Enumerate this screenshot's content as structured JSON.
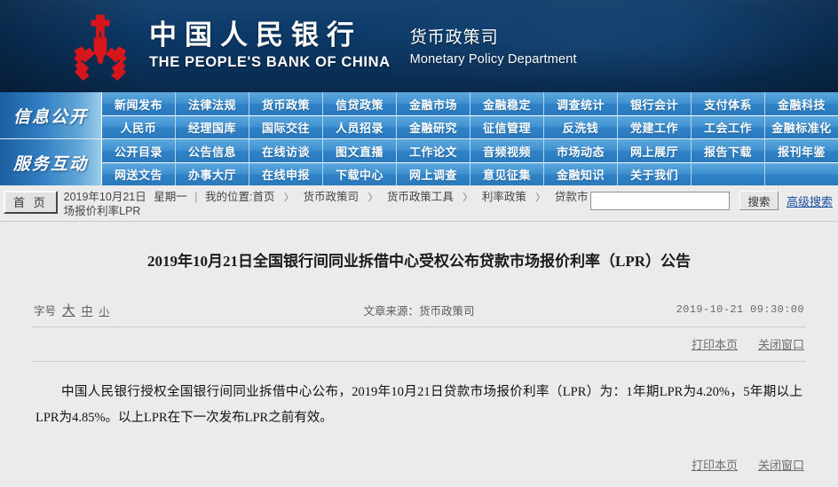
{
  "header": {
    "bank_name_cn": "中国人民银行",
    "bank_name_en": "THE PEOPLE'S BANK OF CHINA",
    "department_cn": "货币政策司",
    "department_en": "Monetary Policy Department",
    "logo_color": "#d7161b",
    "background_color": "#0c3a69"
  },
  "nav": {
    "groups": [
      {
        "side_label": "信息公开",
        "rows": [
          [
            "新闻发布",
            "法律法规",
            "货币政策",
            "信贷政策",
            "金融市场",
            "金融稳定",
            "调查统计",
            "银行会计",
            "支付体系",
            "金融科技"
          ],
          [
            "人民币",
            "经理国库",
            "国际交往",
            "人员招录",
            "金融研究",
            "征信管理",
            "反洗钱",
            "党建工作",
            "工会工作",
            "金融标准化"
          ]
        ]
      },
      {
        "side_label": "服务互动",
        "rows": [
          [
            "公开目录",
            "公告信息",
            "在线访谈",
            "图文直播",
            "工作论文",
            "音频视频",
            "市场动态",
            "网上展厅",
            "报告下载",
            "报刊年鉴"
          ],
          [
            "网送文告",
            "办事大厅",
            "在线申报",
            "下载中心",
            "网上调查",
            "意见征集",
            "金融知识",
            "关于我们",
            "",
            ""
          ]
        ]
      }
    ]
  },
  "breadcrumb": {
    "home_button": "首 页",
    "date": "2019年10月21日",
    "weekday": "星期一",
    "location_label": "我的位置:",
    "items": [
      "首页",
      "货币政策司",
      "货币政策工具",
      "利率政策",
      "贷款市场报价利率LPR"
    ],
    "separator": "〉"
  },
  "search": {
    "value": "",
    "placeholder": "",
    "button_label": "搜索",
    "advanced_label": "高级搜索",
    "link_color": "#1d4fa0"
  },
  "article": {
    "title": "2019年10月21日全国银行间同业拆借中心受权公布贷款市场报价利率（LPR）公告",
    "fontsize_label": "字号",
    "fontsize_options": [
      "大",
      "中",
      "小"
    ],
    "source": "文章来源：货币政策司",
    "timestamp": "2019-10-21 09:30:00",
    "print_label": "打印本页",
    "close_label": "关闭窗口",
    "body": "中国人民银行授权全国银行间同业拆借中心公布，2019年10月21日贷款市场报价利率（LPR）为：1年期LPR为4.20%，5年期以上LPR为4.85%。以上LPR在下一次发布LPR之前有效。"
  }
}
